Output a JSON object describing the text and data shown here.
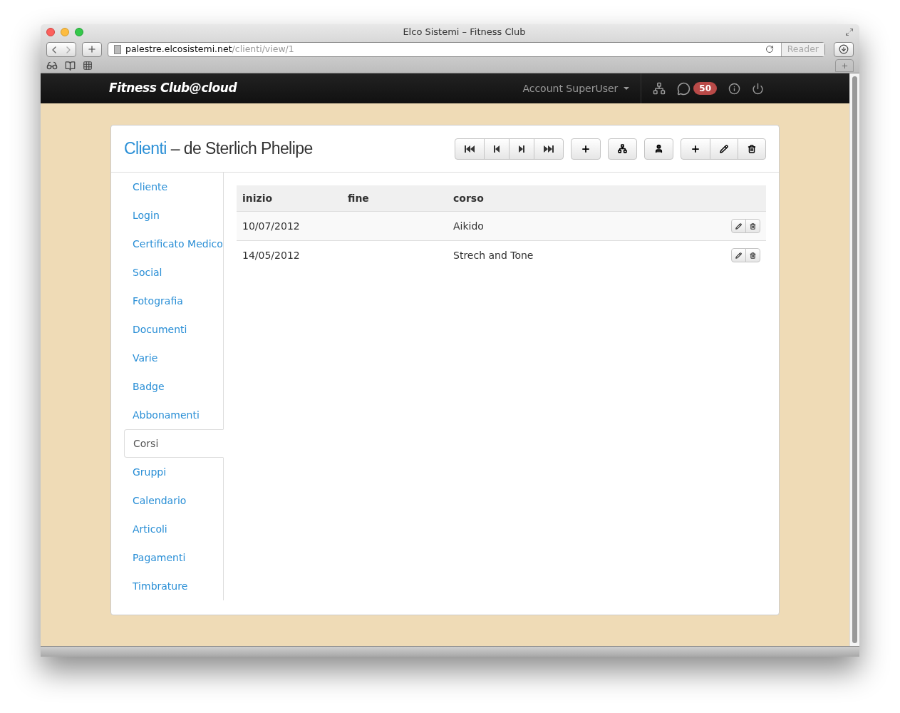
{
  "window": {
    "title": "Elco Sistemi – Fitness Club"
  },
  "address_bar": {
    "host": "palestre.elcosistemi.net",
    "path": "/clienti/view/1",
    "reader": "Reader"
  },
  "navbar": {
    "brand": "Fitness Club@cloud",
    "account": "Account SuperUser",
    "messages_badge": "50"
  },
  "page": {
    "section": "Clienti",
    "separator": "–",
    "title": "de Sterlich Phelipe"
  },
  "sidebar": {
    "items": [
      {
        "label": "Cliente",
        "selected": false
      },
      {
        "label": "Login",
        "selected": false
      },
      {
        "label": "Certificato Medico",
        "selected": false
      },
      {
        "label": "Social",
        "selected": false
      },
      {
        "label": "Fotografia",
        "selected": false
      },
      {
        "label": "Documenti",
        "selected": false
      },
      {
        "label": "Varie",
        "selected": false
      },
      {
        "label": "Badge",
        "selected": false
      },
      {
        "label": "Abbonamenti",
        "selected": false
      },
      {
        "label": "Corsi",
        "selected": true
      },
      {
        "label": "Gruppi",
        "selected": false
      },
      {
        "label": "Calendario",
        "selected": false
      },
      {
        "label": "Articoli",
        "selected": false
      },
      {
        "label": "Pagamenti",
        "selected": false
      },
      {
        "label": "Timbrature",
        "selected": false
      }
    ]
  },
  "table": {
    "columns": [
      "inizio",
      "fine",
      "corso"
    ],
    "rows": [
      {
        "inizio": "10/07/2012",
        "corso": "Aikido"
      },
      {
        "inizio": "14/05/2012",
        "corso": "Strech and Tone"
      }
    ]
  }
}
